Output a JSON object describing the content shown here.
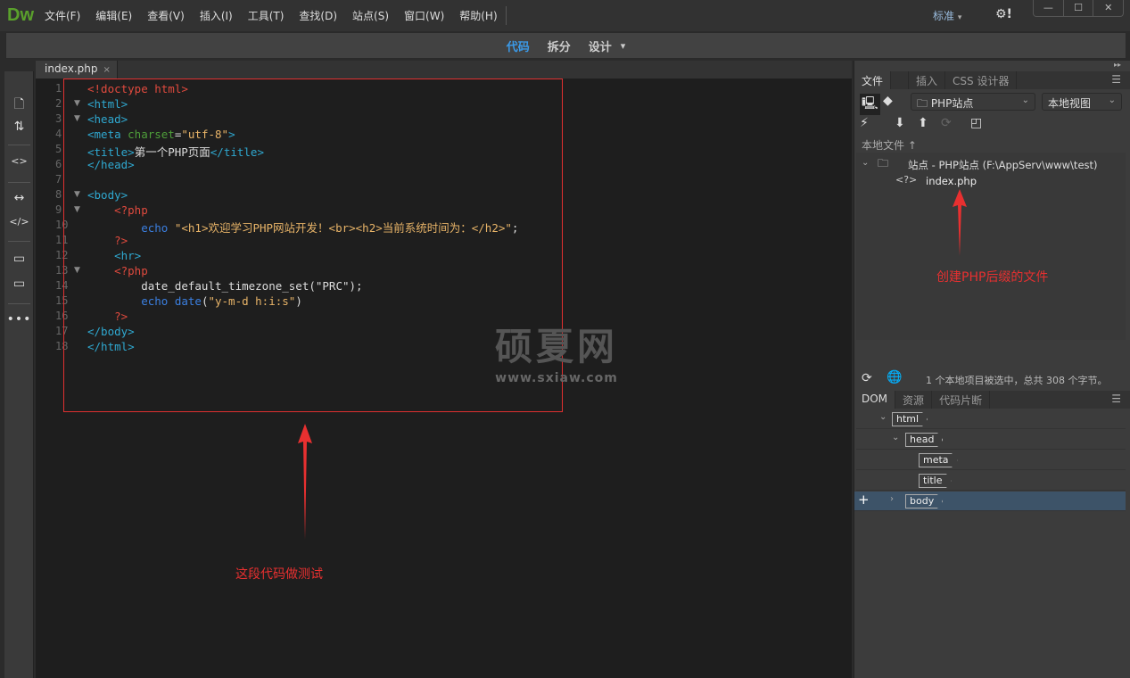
{
  "app": {
    "logo": "Dw",
    "menus": [
      "文件(F)",
      "编辑(E)",
      "查看(V)",
      "插入(I)",
      "工具(T)",
      "查找(D)",
      "站点(S)",
      "窗口(W)",
      "帮助(H)"
    ],
    "workspace": "标准",
    "workspace_chevron": "▾",
    "settings": "⚙!",
    "window_controls": [
      "—",
      "☐",
      "✕"
    ]
  },
  "views": [
    "代码",
    "拆分",
    "设计"
  ],
  "view_active": "代码",
  "view_menu": "▾",
  "editor": {
    "tab": "index.php",
    "tab_close": "×",
    "lines": [
      [
        [
          "r",
          "<!doctype html>"
        ]
      ],
      [
        [
          "t",
          "<html>"
        ]
      ],
      [
        [
          "t",
          "<head>"
        ]
      ],
      [
        [
          "t",
          "<meta "
        ],
        [
          "g",
          "charset"
        ],
        [
          "w",
          "="
        ],
        [
          "s",
          "\"utf-8\""
        ],
        [
          "t",
          ">"
        ]
      ],
      [
        [
          "t",
          "<title>"
        ],
        [
          "w",
          "第一个PHP页面"
        ],
        [
          "t",
          "</title>"
        ]
      ],
      [
        [
          "t",
          "</head>"
        ]
      ],
      [],
      [
        [
          "t",
          "<body>"
        ]
      ],
      [
        [
          "r",
          "    <?php"
        ]
      ],
      [
        [
          "b",
          "        echo "
        ],
        [
          "s",
          "\"<h1>欢迎学习PHP网站开发！<br><h2>当前系统时间为：</h2>\""
        ],
        [
          "w",
          ";"
        ]
      ],
      [
        [
          "r",
          "    ?>"
        ]
      ],
      [
        [
          "t",
          "    <hr>"
        ]
      ],
      [
        [
          "r",
          "    <?php"
        ]
      ],
      [
        [
          "w",
          "        date_default_timezone_set(\"PRC\");"
        ]
      ],
      [
        [
          "b",
          "        echo date"
        ],
        [
          "w",
          "("
        ],
        [
          "s",
          "\"y-m-d h:i:s\""
        ],
        [
          "w",
          ")"
        ]
      ],
      [
        [
          "r",
          "    ?>"
        ]
      ],
      [
        [
          "t",
          "</body>"
        ]
      ],
      [
        [
          "t",
          "</html>"
        ]
      ]
    ],
    "folds": [
      2,
      3,
      8,
      9,
      13
    ]
  },
  "annotations": {
    "code": "这段代码做测试",
    "file": "创建PHP后缀的文件"
  },
  "watermark": {
    "title": "硕夏网",
    "url": "www.sxiaw.com"
  },
  "files_panel": {
    "tabs": [
      "文件",
      "插入",
      "CSS 设计器"
    ],
    "site": "PHP站点",
    "view": "本地视图",
    "column": "本地文件 ↑",
    "site_root": "站点 - PHP站点 (F:\\AppServ\\www\\test)",
    "file": "index.php",
    "file_icon": "<?>",
    "status": "1 个本地项目被选中，总共 308 个字节。"
  },
  "dom_panel": {
    "tabs": [
      "DOM",
      "资源",
      "代码片断"
    ],
    "nodes": [
      "html",
      "head",
      "meta",
      "title",
      "body"
    ],
    "add": "+"
  },
  "colors": {
    "accent": "#3b9ae8",
    "annotation": "#e83030",
    "selection": "#3d5368"
  }
}
